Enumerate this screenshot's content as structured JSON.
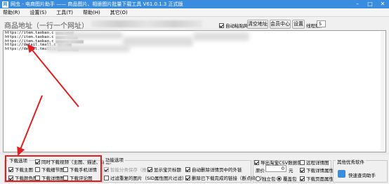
{
  "window": {
    "title": "网虫 - 电商图片助手 —— 商品图片、相册图片批量下载工具 V61.0.1.3 正式版",
    "logo": "网"
  },
  "menu": [
    "帮助(R)",
    "设置(S)",
    "工具(T)",
    "帮助(H)",
    "其它(O)"
  ],
  "toolbar": {
    "url_label": "商品地址（一行一个网址）",
    "auto_paste_label": "自动粘贴网址",
    "auto_paste_checked": true,
    "clear_button": "清空地址",
    "member_button": "会员中心",
    "settings_button": "设置",
    "threads_label": "线程数：",
    "threads_value": "5"
  },
  "url_lines": [
    "https://item.taobao.c",
    "https://item.taobao.c",
    "https://item.taobao.c",
    "https://detail.tmall.c",
    "https://detail.tmall.c"
  ],
  "download_options": {
    "title": "下载选项",
    "items": [
      {
        "label": "同时下载视频（主图、描述、评论）",
        "checked": true
      },
      {
        "label": "下载主图",
        "checked": true
      },
      {
        "label": "下载细节图",
        "checked": false
      },
      {
        "label": "下载手机详情",
        "checked": false
      },
      {
        "label": "下载颜色图",
        "checked": true
      },
      {
        "label": "下载详情图",
        "checked": false
      },
      {
        "label": "下载评论图",
        "checked": false
      }
    ]
  },
  "function_options": {
    "title": "功能选项",
    "items": [
      {
        "label": "智能分类保存（推荐）",
        "checked": true,
        "disabled": true
      },
      {
        "label": "显示宝贝标题",
        "checked": true
      },
      {
        "label": "自动删除详情页中的外链",
        "checked": true
      },
      {
        "label": "过滤重复的图片（SID属性图片过滤）",
        "checked": false
      },
      {
        "label": "删除已下载完成的链接（断点续传）",
        "checked": true
      }
    ]
  },
  "export_options": {
    "export_csv": {
      "label": "导出淘宝CSV数据包",
      "checked": true
    },
    "remote_detail": {
      "label": "远程详情图",
      "checked": false
    },
    "price_label": "原价",
    "price_value": "0",
    "price_unit": "元",
    "download_details_attr": {
      "label": "下载详情属性",
      "checked": true
    },
    "independent": {
      "label": "独立包",
      "checked": false
    },
    "overwrite": {
      "label": "覆盖包",
      "checked": true
    },
    "download_page_attr": {
      "label": "下载页面属性",
      "checked": true
    }
  },
  "recommend": {
    "title": "其他优秀软件",
    "item": "快速查询助手"
  }
}
